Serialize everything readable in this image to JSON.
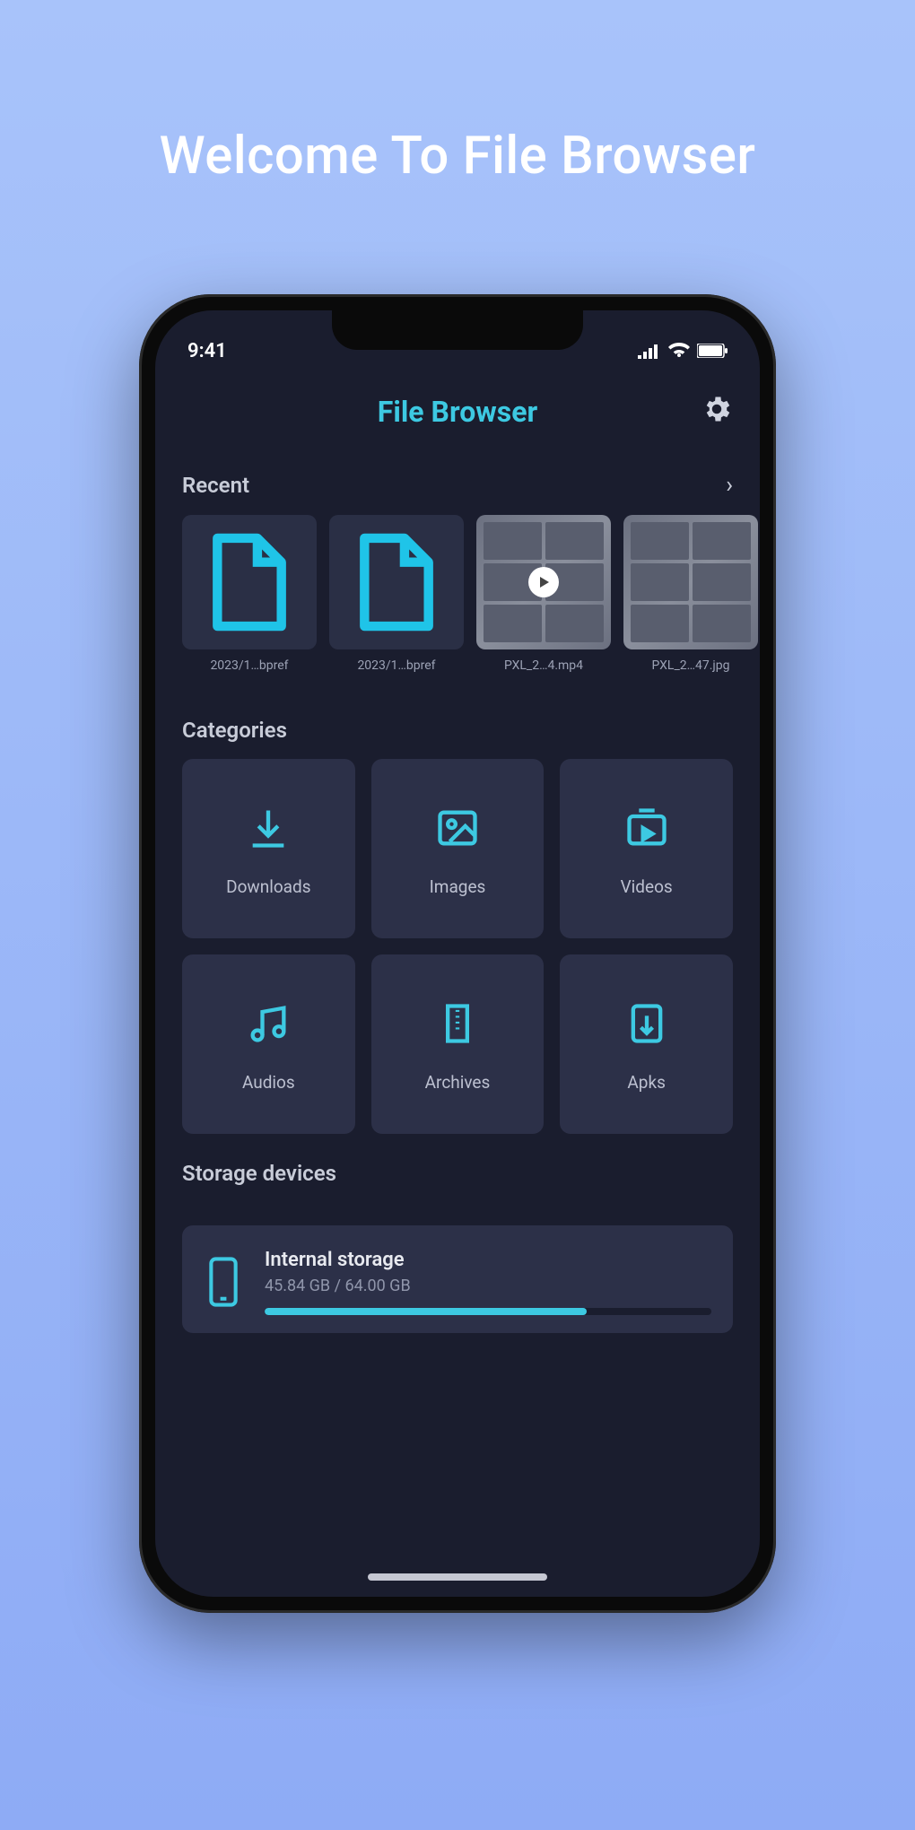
{
  "promo": {
    "title": "Welcome To File Browser"
  },
  "status": {
    "time": "9:41"
  },
  "header": {
    "title": "File Browser"
  },
  "sections": {
    "recent": {
      "title": "Recent"
    },
    "categories": {
      "title": "Categories"
    },
    "storage": {
      "title": "Storage devices"
    }
  },
  "recent_items": [
    {
      "name": "2023/1…bpref",
      "type": "file"
    },
    {
      "name": "2023/1…bpref",
      "type": "file"
    },
    {
      "name": "PXL_2…4.mp4",
      "type": "video"
    },
    {
      "name": "PXL_2…47.jpg",
      "type": "image"
    }
  ],
  "categories": [
    {
      "label": "Downloads",
      "icon": "download"
    },
    {
      "label": "Images",
      "icon": "image"
    },
    {
      "label": "Videos",
      "icon": "video"
    },
    {
      "label": "Audios",
      "icon": "audio"
    },
    {
      "label": "Archives",
      "icon": "archive"
    },
    {
      "label": "Apks",
      "icon": "apk"
    }
  ],
  "storage": {
    "name": "Internal storage",
    "usage": "45.84 GB / 64.00 GB",
    "percent": 72
  },
  "colors": {
    "accent": "#3dc9e2",
    "bg": "#1a1d2e",
    "card": "#2c3048"
  }
}
